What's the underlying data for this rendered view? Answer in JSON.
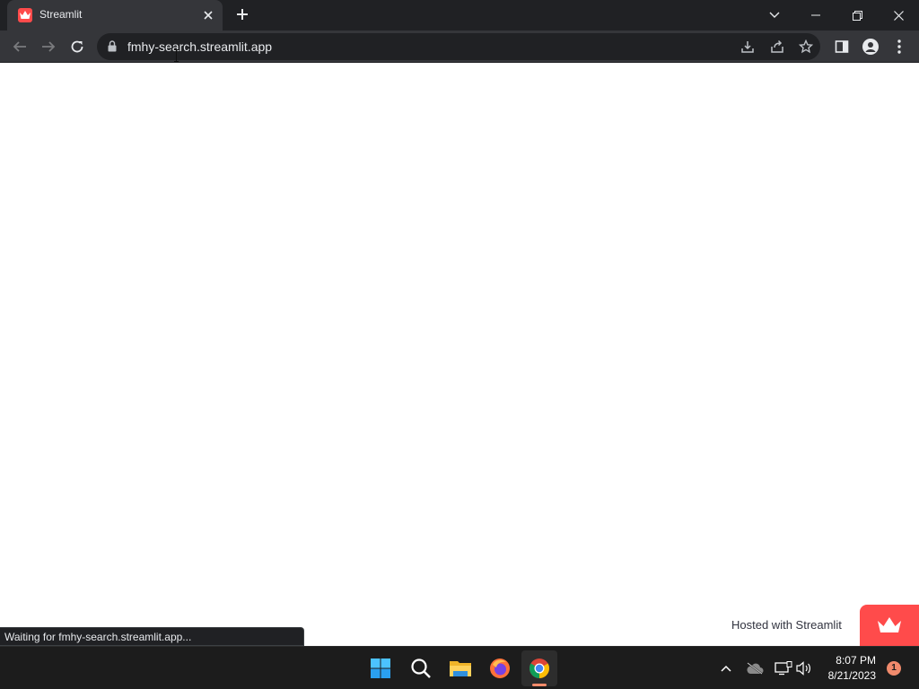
{
  "browser": {
    "tab": {
      "title": "Streamlit"
    },
    "address_bar": {
      "url": "fmhy-search.streamlit.app"
    },
    "status_text": "Waiting for fmhy-search.streamlit.app..."
  },
  "page": {
    "footer_label": "Hosted with Streamlit",
    "accent_color": "#ff4b4b"
  },
  "taskbar": {
    "pinned": [
      "start-icon",
      "search-icon",
      "file-explorer-icon",
      "firefox-icon",
      "chrome-icon"
    ],
    "active_app": "chrome-icon",
    "clock": {
      "time": "8:07 PM",
      "date": "8/21/2023"
    },
    "notification_count": "1"
  }
}
